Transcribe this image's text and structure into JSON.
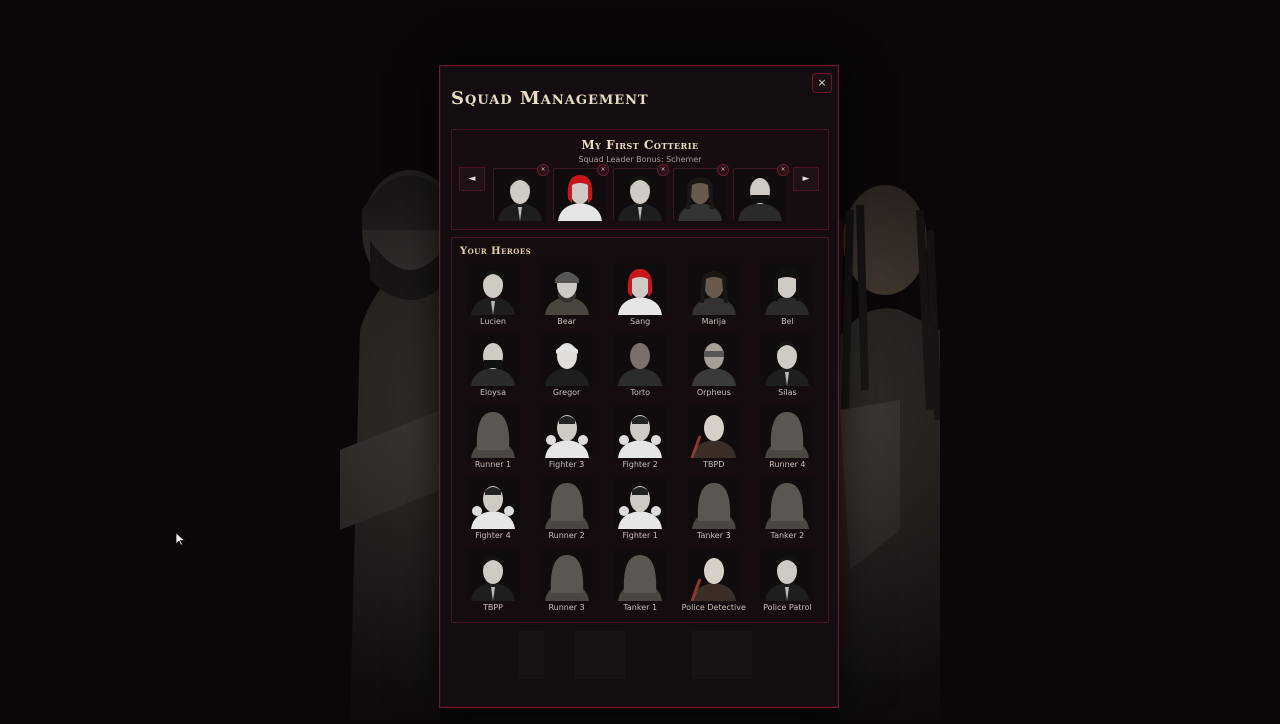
{
  "modal": {
    "title": "Squad Management",
    "close_label": "×"
  },
  "squad": {
    "name": "My First Cotterie",
    "bonus": "Squad Leader Bonus: Schemer",
    "prev_label": "◄",
    "next_label": "►",
    "remove_label": "×",
    "members": [
      "Lucien",
      "Sang",
      "Silas",
      "Marija",
      "Eloysa"
    ]
  },
  "heroes": {
    "title": "Your Heroes",
    "list": [
      {
        "name": "Lucien",
        "icon": "suit-man-portrait"
      },
      {
        "name": "Bear",
        "icon": "bearded-man-portrait"
      },
      {
        "name": "Sang",
        "icon": "red-hair-woman-portrait"
      },
      {
        "name": "Marija",
        "icon": "dreadlocks-woman-portrait"
      },
      {
        "name": "Bel",
        "icon": "dark-hair-woman-portrait"
      },
      {
        "name": "Eloysa",
        "icon": "masked-woman-portrait"
      },
      {
        "name": "Gregor",
        "icon": "old-man-portrait"
      },
      {
        "name": "Torto",
        "icon": "bald-man-portrait"
      },
      {
        "name": "Orpheus",
        "icon": "goggles-man-portrait"
      },
      {
        "name": "Silas",
        "icon": "vampire-portrait"
      },
      {
        "name": "Runner 1",
        "icon": "hooded-figure-portrait"
      },
      {
        "name": "Fighter 3",
        "icon": "fighter-portrait"
      },
      {
        "name": "Fighter 2",
        "icon": "fighter-portrait"
      },
      {
        "name": "TBPD",
        "icon": "bald-monk-portrait"
      },
      {
        "name": "Runner 4",
        "icon": "hooded-figure-portrait"
      },
      {
        "name": "Fighter 4",
        "icon": "fighter-portrait"
      },
      {
        "name": "Runner 2",
        "icon": "hooded-figure-portrait"
      },
      {
        "name": "Fighter 1",
        "icon": "fighter-portrait"
      },
      {
        "name": "Tanker 3",
        "icon": "hooded-tank-portrait"
      },
      {
        "name": "Tanker 2",
        "icon": "hooded-tank-portrait"
      },
      {
        "name": "TBPP",
        "icon": "vampire-portrait"
      },
      {
        "name": "Runner 3",
        "icon": "hooded-figure-portrait"
      },
      {
        "name": "Tanker 1",
        "icon": "hooded-tank-portrait"
      },
      {
        "name": "Police Detective",
        "icon": "bald-monk-portrait"
      },
      {
        "name": "Police Patrol",
        "icon": "vampire-portrait"
      }
    ]
  },
  "colors": {
    "accent": "#6a1a2a",
    "title": "#e9dcc2",
    "hair_red": "#c8171c"
  }
}
